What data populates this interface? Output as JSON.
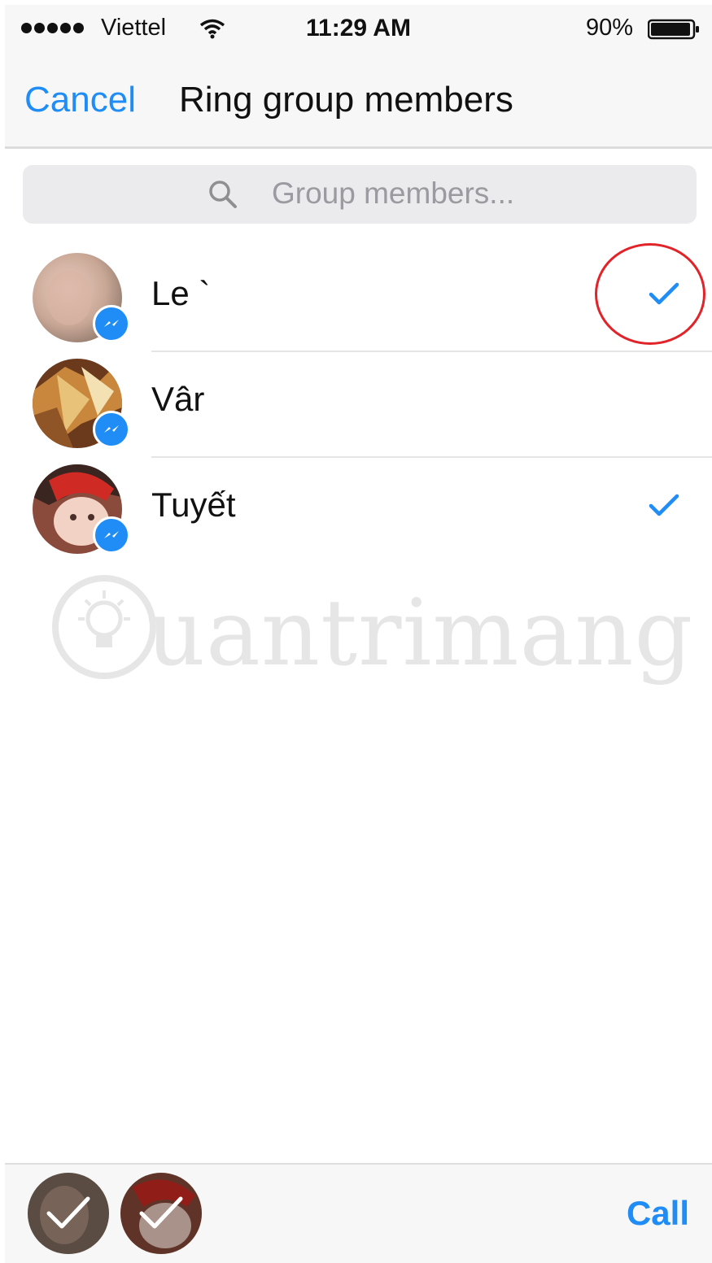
{
  "status_bar": {
    "carrier": "Viettel",
    "time": "11:29 AM",
    "battery": "90%"
  },
  "nav": {
    "cancel_label": "Cancel",
    "title": "Ring group members"
  },
  "search": {
    "placeholder": "Group members..."
  },
  "members": [
    {
      "name": "Le `",
      "selected": true
    },
    {
      "name": "Vâr",
      "selected": false
    },
    {
      "name": "Tuyết",
      "selected": true
    }
  ],
  "watermark": {
    "text": "uantrimang"
  },
  "bottom": {
    "call_label": "Call"
  },
  "colors": {
    "accent": "#1f8df5",
    "annotation": "#e0242a"
  }
}
